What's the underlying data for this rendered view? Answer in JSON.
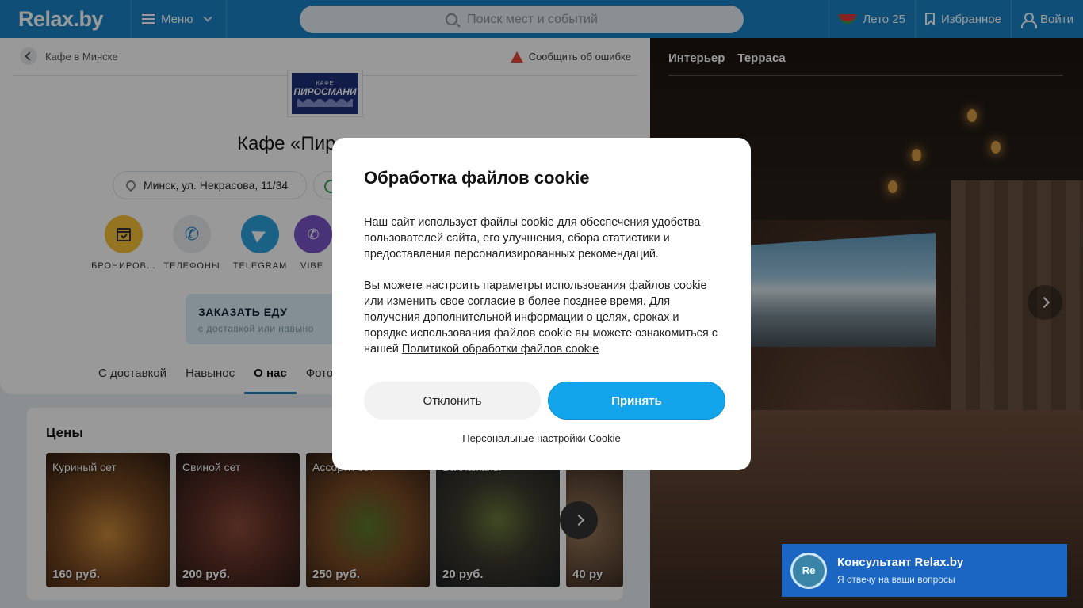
{
  "header": {
    "logo": "Relax.by",
    "menu_label": "Меню",
    "search_placeholder": "Поиск мест и событий",
    "summer_label": "Лето 25",
    "favorites_label": "Избранное",
    "login_label": "Войти"
  },
  "left": {
    "breadcrumb": "Кафе в Минске",
    "report": "Сообщить об ошибке",
    "logo_small": "КАФЕ",
    "logo_big": "ПИРОСМАНИ",
    "title": "Кафе «Пир",
    "address": "Минск, ул. Некрасова, 11/34",
    "actions": [
      "БРОНИРОВ…",
      "ТЕЛЕФОНЫ",
      "TELEGRAM",
      "VIBE"
    ],
    "order_title": "ЗАКАЗАТЬ ЕДУ",
    "order_sub": "с доставкой или навыно",
    "tabs": [
      "С доставкой",
      "Навынос",
      "О нас",
      "Фото"
    ]
  },
  "prices": {
    "title": "Цены",
    "items": [
      {
        "name": "Куриный сет",
        "price": "160 руб."
      },
      {
        "name": "Свиной сет",
        "price": "200 руб."
      },
      {
        "name": "Ассорти сет",
        "price": "250 руб."
      },
      {
        "name": "Баклажаны",
        "price": "20 руб."
      },
      {
        "name": "",
        "price": "40 ру"
      }
    ]
  },
  "photo": {
    "tabs": [
      "Интерьер",
      "Терраса"
    ]
  },
  "cookie": {
    "title": "Обработка файлов cookie",
    "p1": "Наш сайт использует файлы cookie для обеспечения удобства пользователей сайта, его улучшения, сбора статистики и предоставления персонализированных рекомендаций.",
    "p2": "Вы можете настроить параметры использования файлов cookie или изменить свое согласие в более позднее время. Для получения дополнительной информации о целях, сроках и порядке использования файлов cookie вы можете ознакомиться с нашей",
    "policy_link": "Политикой обработки файлов cookie",
    "decline": "Отклонить",
    "accept": "Принять",
    "personal": "Персональные настройки Cookie"
  },
  "consultant": {
    "avatar": "Re",
    "title": "Консультант Relax.by",
    "subtitle": "Я отвечу на ваши вопросы"
  },
  "colors": {
    "brand": "#1a83c6",
    "accept": "#13a5eb",
    "consultant": "#1a66c2"
  }
}
